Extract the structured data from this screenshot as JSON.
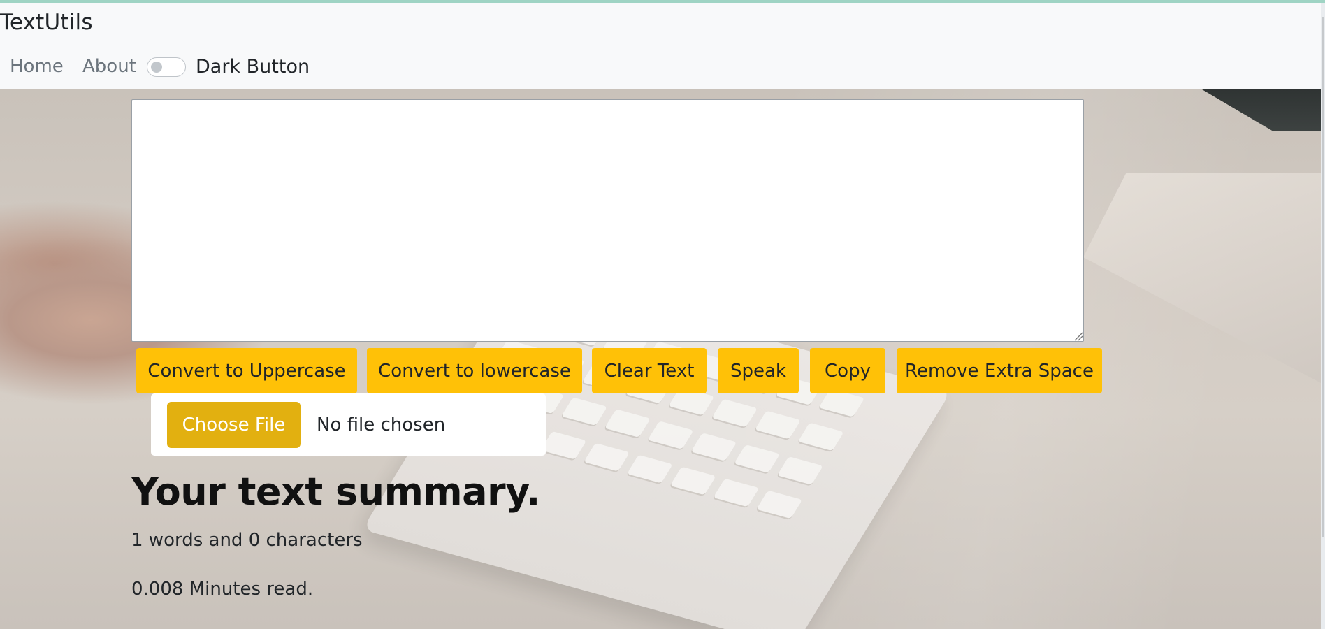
{
  "navbar": {
    "brand": "TextUtils",
    "links": [
      {
        "label": "Home"
      },
      {
        "label": "About"
      }
    ],
    "toggle": {
      "label": "Dark Button",
      "checked": false
    }
  },
  "editor": {
    "value": "",
    "placeholder": ""
  },
  "actions": [
    {
      "label": "Convert to Uppercase"
    },
    {
      "label": "Convert to lowercase"
    },
    {
      "label": "Clear Text"
    },
    {
      "label": "Speak"
    },
    {
      "label": "Copy"
    },
    {
      "label": "Remove Extra Space"
    }
  ],
  "file_input": {
    "button_label": "Choose File",
    "status": "No file chosen"
  },
  "summary": {
    "title": "Your text summary.",
    "counts": "1 words and 0 characters",
    "read_time": "0.008 Minutes read."
  },
  "colors": {
    "accent": "#ffc107",
    "file_button": "#e2b010",
    "navbar_bg": "#f8f9fa"
  }
}
